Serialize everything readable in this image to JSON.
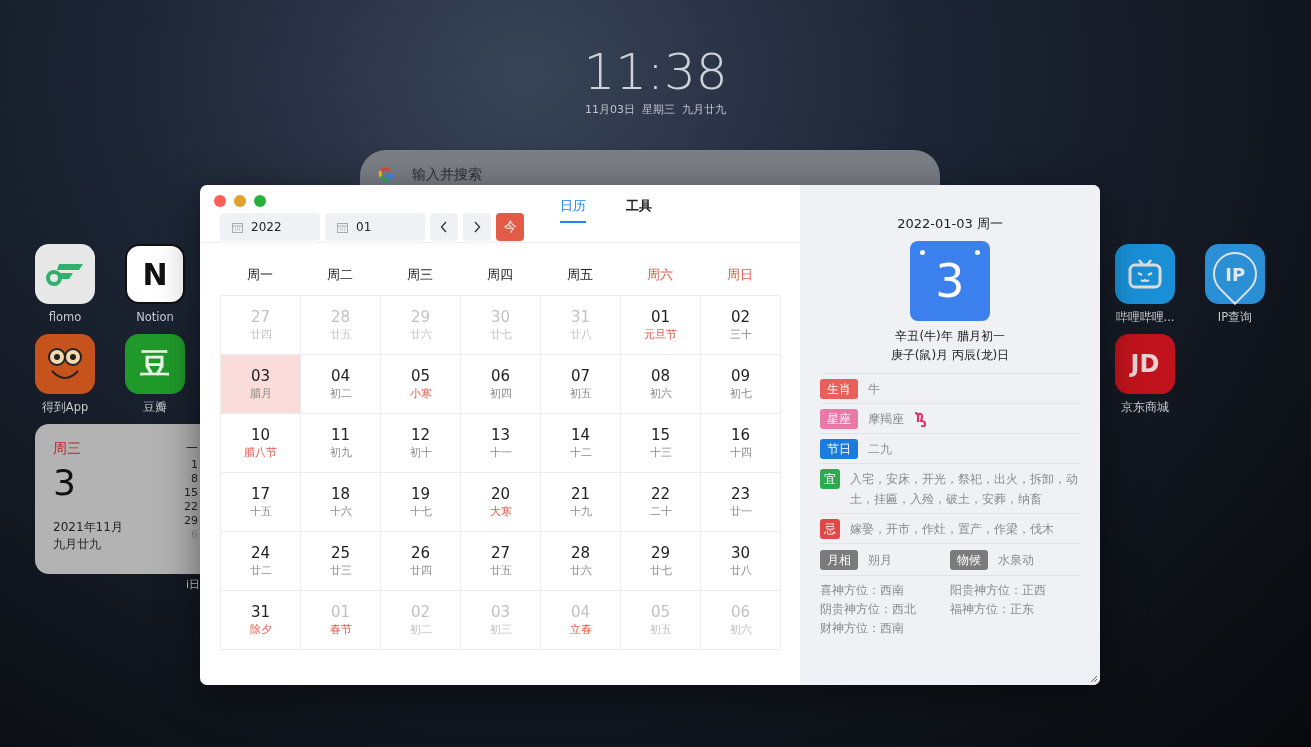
{
  "clock": {
    "time": "11:38",
    "date": "11月03日  星期三  九月廿九"
  },
  "search": {
    "placeholder": "输入并搜索"
  },
  "apps": [
    {
      "name": "flomo",
      "kind": "flomo"
    },
    {
      "name": "Notion",
      "kind": "notion",
      "glyph": "N"
    },
    {
      "name": "得到App",
      "kind": "owl"
    },
    {
      "name": "豆瓣",
      "kind": "douban",
      "glyph": "豆"
    },
    {
      "name": "哔哩哔哩...",
      "kind": "tv"
    },
    {
      "name": "IP查询",
      "kind": "pin",
      "glyph": "IP"
    },
    {
      "name": "京东商城",
      "kind": "jd",
      "glyph": "JD"
    }
  ],
  "widget": {
    "weekday": "周三",
    "day": "3",
    "month": "2021年11月",
    "lunar": "九月廿九",
    "mini_header": "一",
    "mini_dates": [
      {
        "text": "1",
        "other_month": false
      },
      {
        "text": "8",
        "other_month": false
      },
      {
        "text": "15",
        "other_month": false
      },
      {
        "text": "22",
        "other_month": false
      },
      {
        "text": "29",
        "other_month": false
      },
      {
        "text": "6",
        "other_month": true
      }
    ],
    "caption": "i日"
  },
  "window": {
    "year": "2022",
    "month": "01",
    "today_button": "今",
    "tabs": [
      {
        "label": "日历",
        "selected": true
      },
      {
        "label": "工具",
        "selected": false
      }
    ],
    "weekdays": [
      {
        "label": "周一",
        "weekend": false
      },
      {
        "label": "周二",
        "weekend": false
      },
      {
        "label": "周三",
        "weekend": false
      },
      {
        "label": "周四",
        "weekend": false
      },
      {
        "label": "周五",
        "weekend": false
      },
      {
        "label": "周六",
        "weekend": true
      },
      {
        "label": "周日",
        "weekend": true
      }
    ],
    "weeks": [
      [
        {
          "day": "27",
          "lunar": "廿四",
          "other_month": true,
          "festival": false,
          "selected": false
        },
        {
          "day": "28",
          "lunar": "廿五",
          "other_month": true,
          "festival": false,
          "selected": false
        },
        {
          "day": "29",
          "lunar": "廿六",
          "other_month": true,
          "festival": false,
          "selected": false
        },
        {
          "day": "30",
          "lunar": "廿七",
          "other_month": true,
          "festival": false,
          "selected": false
        },
        {
          "day": "31",
          "lunar": "廿八",
          "other_month": true,
          "festival": false,
          "selected": false
        },
        {
          "day": "01",
          "lunar": "元旦节",
          "other_month": false,
          "festival": true,
          "selected": false
        },
        {
          "day": "02",
          "lunar": "三十",
          "other_month": false,
          "festival": false,
          "selected": false
        }
      ],
      [
        {
          "day": "03",
          "lunar": "腊月",
          "other_month": false,
          "festival": false,
          "selected": true
        },
        {
          "day": "04",
          "lunar": "初二",
          "other_month": false,
          "festival": false,
          "selected": false
        },
        {
          "day": "05",
          "lunar": "小寒",
          "other_month": false,
          "festival": true,
          "selected": false
        },
        {
          "day": "06",
          "lunar": "初四",
          "other_month": false,
          "festival": false,
          "selected": false
        },
        {
          "day": "07",
          "lunar": "初五",
          "other_month": false,
          "festival": false,
          "selected": false
        },
        {
          "day": "08",
          "lunar": "初六",
          "other_month": false,
          "festival": false,
          "selected": false
        },
        {
          "day": "09",
          "lunar": "初七",
          "other_month": false,
          "festival": false,
          "selected": false
        }
      ],
      [
        {
          "day": "10",
          "lunar": "腊八节",
          "other_month": false,
          "festival": true,
          "selected": false
        },
        {
          "day": "11",
          "lunar": "初九",
          "other_month": false,
          "festival": false,
          "selected": false
        },
        {
          "day": "12",
          "lunar": "初十",
          "other_month": false,
          "festival": false,
          "selected": false
        },
        {
          "day": "13",
          "lunar": "十一",
          "other_month": false,
          "festival": false,
          "selected": false
        },
        {
          "day": "14",
          "lunar": "十二",
          "other_month": false,
          "festival": false,
          "selected": false
        },
        {
          "day": "15",
          "lunar": "十三",
          "other_month": false,
          "festival": false,
          "selected": false
        },
        {
          "day": "16",
          "lunar": "十四",
          "other_month": false,
          "festival": false,
          "selected": false
        }
      ],
      [
        {
          "day": "17",
          "lunar": "十五",
          "other_month": false,
          "festival": false,
          "selected": false
        },
        {
          "day": "18",
          "lunar": "十六",
          "other_month": false,
          "festival": false,
          "selected": false
        },
        {
          "day": "19",
          "lunar": "十七",
          "other_month": false,
          "festival": false,
          "selected": false
        },
        {
          "day": "20",
          "lunar": "大寒",
          "other_month": false,
          "festival": true,
          "selected": false
        },
        {
          "day": "21",
          "lunar": "十九",
          "other_month": false,
          "festival": false,
          "selected": false
        },
        {
          "day": "22",
          "lunar": "二十",
          "other_month": false,
          "festival": false,
          "selected": false
        },
        {
          "day": "23",
          "lunar": "廿一",
          "other_month": false,
          "festival": false,
          "selected": false
        }
      ],
      [
        {
          "day": "24",
          "lunar": "廿二",
          "other_month": false,
          "festival": false,
          "selected": false
        },
        {
          "day": "25",
          "lunar": "廿三",
          "other_month": false,
          "festival": false,
          "selected": false
        },
        {
          "day": "26",
          "lunar": "廿四",
          "other_month": false,
          "festival": false,
          "selected": false
        },
        {
          "day": "27",
          "lunar": "廿五",
          "other_month": false,
          "festival": false,
          "selected": false
        },
        {
          "day": "28",
          "lunar": "廿六",
          "other_month": false,
          "festival": false,
          "selected": false
        },
        {
          "day": "29",
          "lunar": "廿七",
          "other_month": false,
          "festival": false,
          "selected": false
        },
        {
          "day": "30",
          "lunar": "廿八",
          "other_month": false,
          "festival": false,
          "selected": false
        }
      ],
      [
        {
          "day": "31",
          "lunar": "除夕",
          "other_month": false,
          "festival": true,
          "selected": false
        },
        {
          "day": "01",
          "lunar": "春节",
          "other_month": true,
          "festival": true,
          "selected": false
        },
        {
          "day": "02",
          "lunar": "初二",
          "other_month": true,
          "festival": false,
          "selected": false
        },
        {
          "day": "03",
          "lunar": "初三",
          "other_month": true,
          "festival": false,
          "selected": false
        },
        {
          "day": "04",
          "lunar": "立春",
          "other_month": true,
          "festival": true,
          "selected": false
        },
        {
          "day": "05",
          "lunar": "初五",
          "other_month": true,
          "festival": false,
          "selected": false
        },
        {
          "day": "06",
          "lunar": "初六",
          "other_month": true,
          "festival": false,
          "selected": false
        }
      ]
    ]
  },
  "detail": {
    "date_title": "2022-01-03 周一",
    "big_day": "3",
    "lunar_lines": [
      "辛丑(牛)年 腊月初一",
      "庚子(鼠)月 丙辰(龙)日"
    ],
    "facts": [
      {
        "kind": "label",
        "tag": "生肖",
        "value": "牛",
        "color": "#e9605b"
      },
      {
        "kind": "sign",
        "tag": "星座",
        "value": "摩羯座",
        "color": "#e97aa7"
      },
      {
        "kind": "label",
        "tag": "节日",
        "value": "二九",
        "color": "#1b7ce0"
      },
      {
        "kind": "square",
        "tag": "宜",
        "value": "入宅，安床，开光，祭祀，出火，拆卸，动土，挂匾，入殓，破土，安葬，纳畜",
        "color": "#2fa84f"
      },
      {
        "kind": "square",
        "tag": "忌",
        "value": "嫁娶，开市，作灶，置产，作梁，伐木",
        "color": "#e04848"
      }
    ],
    "pairs": [
      {
        "tag": "月相",
        "value": "朔月"
      },
      {
        "tag": "物候",
        "value": "水泉动"
      }
    ],
    "directions": [
      "喜神方位：西南",
      "阳贵神方位：正西",
      "阴贵神方位：西北",
      "福神方位：正东",
      "财神方位：西南"
    ]
  }
}
